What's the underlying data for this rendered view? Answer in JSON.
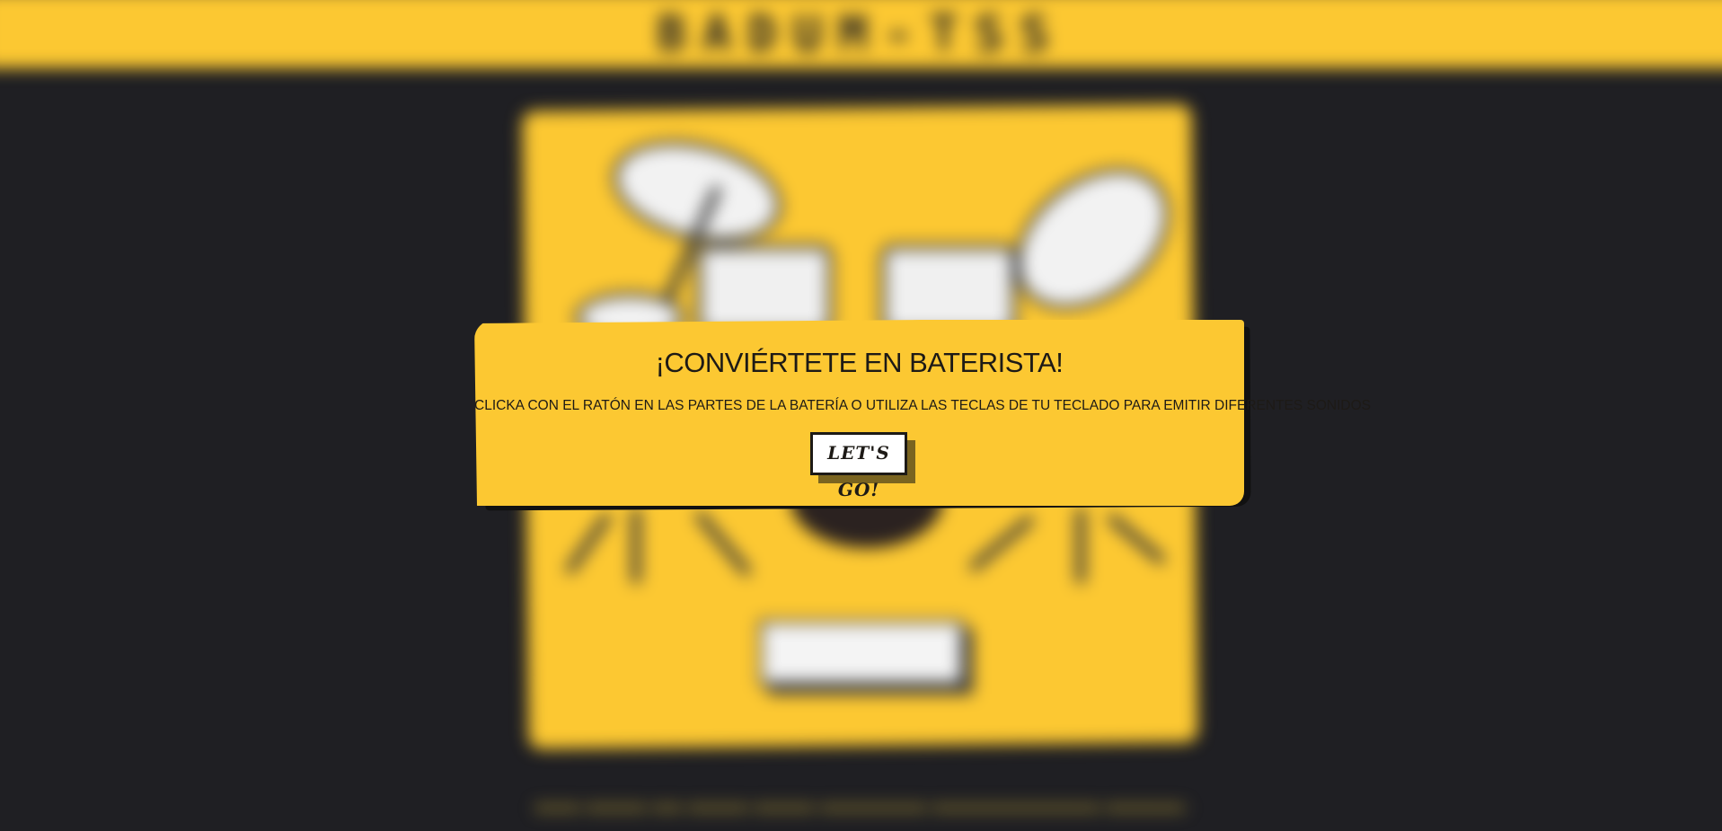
{
  "app": {
    "brand": "BADUM-TSS"
  },
  "modal": {
    "title": "¡CONVIÉRTETE EN BATERISTA!",
    "instructions": "CLICKA CON EL RATÓN EN LAS PARTES DE LA BATERÍA O UTILIZA LAS TECLAS DE TU TECLADO PARA EMITIR DIFERENTES SONIDOS",
    "start_button": "LET'S GO!"
  },
  "colors": {
    "accent": "#fcc832",
    "background": "#1f1f23",
    "ink": "#1d1a16"
  }
}
